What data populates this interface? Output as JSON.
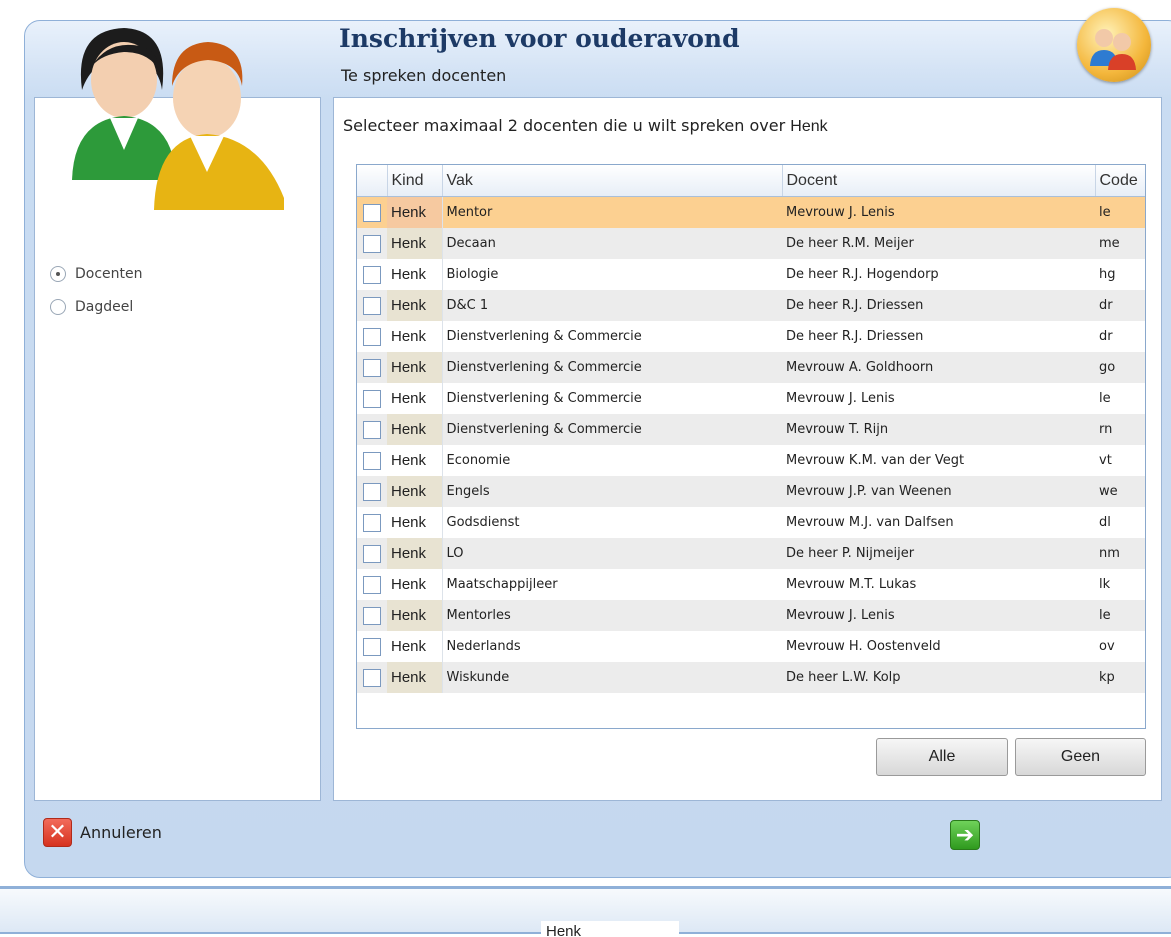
{
  "header": {
    "title": "Inschrijven voor ouderavond",
    "subtitle": "Te spreken docenten"
  },
  "sidebar": {
    "options": [
      {
        "label": "Docenten",
        "selected": true
      },
      {
        "label": "Dagdeel",
        "selected": false
      }
    ]
  },
  "main": {
    "instruction": "Selecteer maximaal 2 docenten die u wilt spreken over",
    "child": "Henk"
  },
  "grid": {
    "columns": [
      "Kind",
      "Vak",
      "Docent",
      "Code"
    ],
    "rows": [
      {
        "kind": "Henk",
        "vak": "Mentor",
        "docent": "Mevrouw J. Lenis",
        "code": "le",
        "selected": true
      },
      {
        "kind": "Henk",
        "vak": "Decaan",
        "docent": "De heer R.M. Meijer",
        "code": "me"
      },
      {
        "kind": "Henk",
        "vak": "Biologie",
        "docent": "De heer R.J. Hogendorp",
        "code": "hg"
      },
      {
        "kind": "Henk",
        "vak": "D&C 1",
        "docent": "De heer R.J. Driessen",
        "code": "dr"
      },
      {
        "kind": "Henk",
        "vak": "Dienstverlening & Commercie",
        "docent": "De heer R.J. Driessen",
        "code": "dr"
      },
      {
        "kind": "Henk",
        "vak": "Dienstverlening & Commercie",
        "docent": "Mevrouw A. Goldhoorn",
        "code": "go"
      },
      {
        "kind": "Henk",
        "vak": "Dienstverlening & Commercie",
        "docent": "Mevrouw J. Lenis",
        "code": "le"
      },
      {
        "kind": "Henk",
        "vak": "Dienstverlening & Commercie",
        "docent": "Mevrouw T. Rijn",
        "code": "rn"
      },
      {
        "kind": "Henk",
        "vak": "Economie",
        "docent": "Mevrouw K.M. van der Vegt",
        "code": "vt"
      },
      {
        "kind": "Henk",
        "vak": "Engels",
        "docent": "Mevrouw J.P. van Weenen",
        "code": "we"
      },
      {
        "kind": "Henk",
        "vak": "Godsdienst",
        "docent": "Mevrouw M.J. van Dalfsen",
        "code": "dl"
      },
      {
        "kind": "Henk",
        "vak": "LO",
        "docent": "De heer P. Nijmeijer",
        "code": "nm"
      },
      {
        "kind": "Henk",
        "vak": "Maatschappijleer",
        "docent": "Mevrouw M.T. Lukas",
        "code": "lk"
      },
      {
        "kind": "Henk",
        "vak": "Mentorles",
        "docent": "Mevrouw J. Lenis",
        "code": "le"
      },
      {
        "kind": "Henk",
        "vak": "Nederlands",
        "docent": "Mevrouw H. Oostenveld",
        "code": "ov"
      },
      {
        "kind": "Henk",
        "vak": "Wiskunde",
        "docent": "De heer L.W. Kolp",
        "code": "kp"
      }
    ]
  },
  "buttons": {
    "all": "Alle",
    "none": "Geen",
    "cancel": "Annuleren"
  },
  "footer": {
    "tab": "Henk"
  },
  "icons": {
    "cancel": "close-icon",
    "next": "arrow-right-icon",
    "users": "users-icon"
  },
  "colors": {
    "title": "#1d3a66",
    "selected_row": "#fcd091",
    "cancel": "#d6321f",
    "next": "#2f9a1e"
  }
}
